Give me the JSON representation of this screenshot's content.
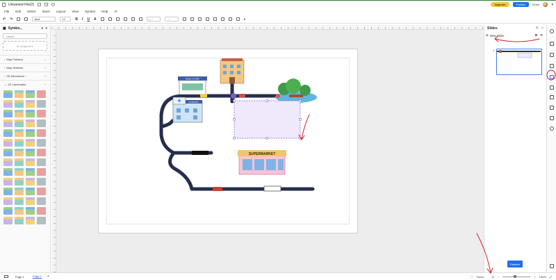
{
  "titlebar": {
    "doc_title": "Unnamed File(2)",
    "upgrade_label": "Upgrade",
    "publish_label": "Publish",
    "share_label": "Share"
  },
  "menu": [
    "File",
    "Edit",
    "Select",
    "Insert",
    "Layout",
    "View",
    "Symbol",
    "Help",
    "AI"
  ],
  "toolbar": {
    "font_family": "Arial",
    "font_size": "12"
  },
  "left_panel": {
    "title": "Symbo...",
    "search_placeholder": "collect",
    "drop_label": "Drag Here",
    "sections": [
      {
        "label": "Map Pointers"
      },
      {
        "label": "Map Vehicles"
      },
      {
        "label": "2D Directional ..."
      },
      {
        "label": "2D Landmarks"
      }
    ]
  },
  "slides_panel": {
    "title": "Slides",
    "new_slide_label": "New Slide",
    "thumb_number": "1",
    "present_label": "Present"
  },
  "diagram": {
    "shop_label": "SUPERMARKET",
    "small_sign_label": "BANK STORE",
    "hospital_sign_label": "HOSPITAL"
  },
  "statusbar": {
    "page_selector": "Page-1",
    "page_tab": "Page-1",
    "add_label": "+",
    "focus_label": "Focus",
    "zoom": "100%"
  },
  "colors": {
    "road": "#262e4d",
    "accent": "#1e6ff2",
    "upgrade": "#f5c242",
    "annotation": "#d32121",
    "selection": "#7b5cc9"
  }
}
